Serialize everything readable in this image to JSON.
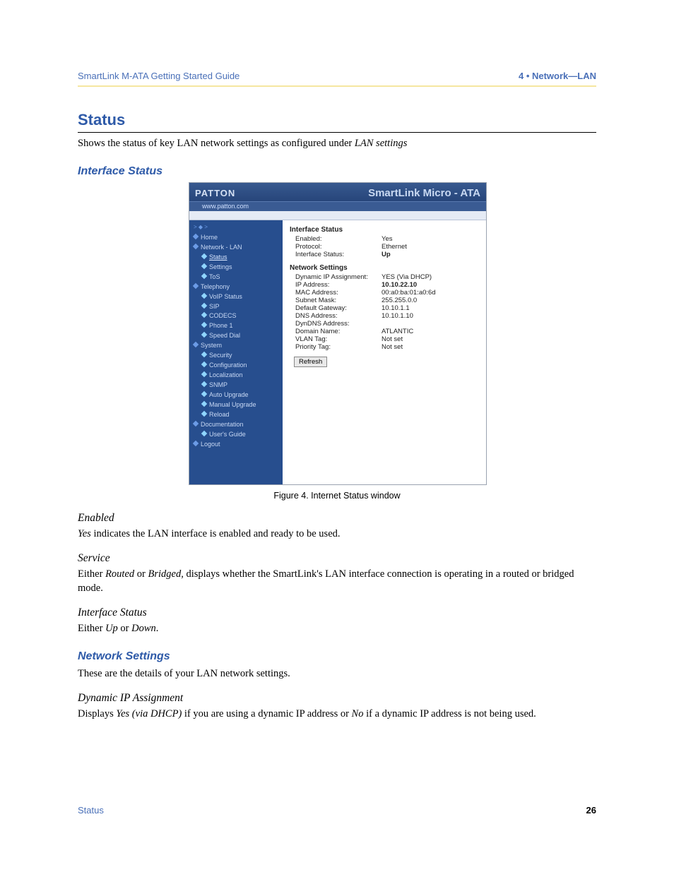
{
  "header": {
    "left": "SmartLink M-ATA Getting Started Guide",
    "right": "4 • Network—LAN"
  },
  "section": {
    "title": "Status",
    "intro_before": "Shows the status of key LAN network settings as configured under ",
    "intro_em": "LAN settings"
  },
  "interface_status_title": "Interface Status",
  "figure": {
    "caption": "Figure 4. Internet Status window",
    "logo": "PATTON",
    "product": "SmartLink Micro - ATA",
    "url": "www.patton.com",
    "crumb": "> ◆ >",
    "nav": [
      {
        "level": "l1",
        "kind": "b-blue",
        "label": "Home"
      },
      {
        "level": "l1",
        "kind": "b-blue",
        "label": "Network - LAN"
      },
      {
        "level": "l2",
        "kind": "b-cyan",
        "label": "Status",
        "sel": true
      },
      {
        "level": "l2",
        "kind": "b-cyan",
        "label": "Settings"
      },
      {
        "level": "l2",
        "kind": "b-cyan",
        "label": "ToS"
      },
      {
        "level": "l1",
        "kind": "b-blue",
        "label": "Telephony"
      },
      {
        "level": "l2",
        "kind": "b-cyan",
        "label": "VoIP Status"
      },
      {
        "level": "l2",
        "kind": "b-cyan",
        "label": "SIP"
      },
      {
        "level": "l2",
        "kind": "b-cyan",
        "label": "CODECS"
      },
      {
        "level": "l2",
        "kind": "b-cyan",
        "label": "Phone 1"
      },
      {
        "level": "l2",
        "kind": "b-cyan",
        "label": "Speed Dial"
      },
      {
        "level": "l1",
        "kind": "b-blue",
        "label": "System"
      },
      {
        "level": "l2",
        "kind": "b-cyan",
        "label": "Security"
      },
      {
        "level": "l2",
        "kind": "b-cyan",
        "label": "Configuration"
      },
      {
        "level": "l2",
        "kind": "b-cyan",
        "label": "Localization"
      },
      {
        "level": "l2",
        "kind": "b-cyan",
        "label": "SNMP"
      },
      {
        "level": "l2",
        "kind": "b-cyan",
        "label": "Auto Upgrade"
      },
      {
        "level": "l2",
        "kind": "b-cyan",
        "label": "Manual Upgrade"
      },
      {
        "level": "l2",
        "kind": "b-cyan",
        "label": "Reload"
      },
      {
        "level": "l1",
        "kind": "b-blue",
        "label": "Documentation"
      },
      {
        "level": "l2",
        "kind": "b-cyan",
        "label": "User's Guide"
      },
      {
        "level": "l1",
        "kind": "b-blue",
        "label": "Logout"
      }
    ],
    "group1": {
      "head": "Interface Status",
      "rows": [
        {
          "k": "Enabled:",
          "v": "Yes"
        },
        {
          "k": "Protocol:",
          "v": "Ethernet"
        },
        {
          "k": "Interface Status:",
          "v": "Up",
          "bold": true
        }
      ]
    },
    "group2": {
      "head": "Network Settings",
      "rows": [
        {
          "k": "Dynamic IP Assignment:",
          "v": "YES (Via DHCP)"
        },
        {
          "k": "IP Address:",
          "v": "10.10.22.10",
          "bold": true
        },
        {
          "k": "MAC Address:",
          "v": "00:a0:ba:01:a0:6d"
        },
        {
          "k": "Subnet Mask:",
          "v": "255.255.0.0"
        },
        {
          "k": "Default Gateway:",
          "v": "10.10.1.1"
        },
        {
          "k": "DNS Address:",
          "v": "10.10.1.10"
        },
        {
          "k": "DynDNS Address:",
          "v": ""
        },
        {
          "k": "Domain Name:",
          "v": "ATLANTIC"
        },
        {
          "k": "VLAN Tag:",
          "v": "Not set"
        },
        {
          "k": "Priority Tag:",
          "v": "Not set"
        }
      ]
    },
    "refresh": "Refresh"
  },
  "blocks": {
    "enabled_head": "Enabled",
    "enabled_em": "Yes",
    "enabled_rest": " indicates the LAN interface is enabled and ready to be used.",
    "service_head": "Service",
    "service_p1": "Either ",
    "service_em1": "Routed",
    "service_p2": " or ",
    "service_em2": "Bridged",
    "service_p3": ", displays whether the SmartLink's LAN interface connection is operating in a routed or bridged mode.",
    "if_head": "Interface Status",
    "if_p1": "Either ",
    "if_em1": "Up",
    "if_p2": " or ",
    "if_em2": "Down",
    "if_p3": ".",
    "net_title": "Network Settings",
    "net_intro": "These are the details of your LAN network settings.",
    "dyn_head": "Dynamic IP Assignment",
    "dyn_p1": "Displays ",
    "dyn_em1": "Yes (via DHCP)",
    "dyn_p2": " if you are using a dynamic IP address or ",
    "dyn_em2": "No",
    "dyn_p3": " if a dynamic IP address is not being used."
  },
  "footer": {
    "left": "Status",
    "right": "26"
  }
}
